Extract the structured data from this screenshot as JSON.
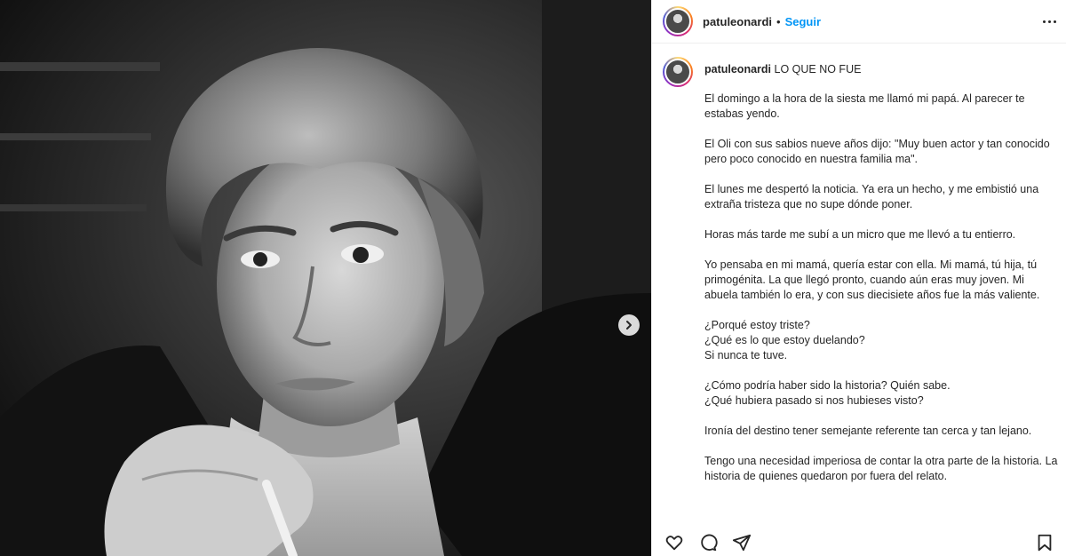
{
  "post": {
    "username": "patuleonardi",
    "separator": "•",
    "follow_label": "Seguir",
    "more_icon": "more-horizontal-icon"
  },
  "caption": {
    "username": "patuleonardi",
    "title": "LO QUE NO FUE",
    "paragraphs": [
      "El domingo a la hora de la siesta me llamó mi papá. Al parecer te estabas yendo.",
      "El Oli con sus sabios nueve años dijo: \"Muy buen actor y tan conocido pero poco conocido en nuestra familia ma\".",
      "El lunes me despertó la noticia. Ya era un hecho, y me embistió una extraña tristeza que no supe dónde poner.",
      "Horas más tarde me subí a un micro que me llevó a tu entierro.",
      "Yo pensaba en mi mamá, quería estar con ella. Mi mamá, tú hija, tú primogénita. La que llegó pronto, cuando aún eras muy joven. Mi abuela también lo era, y con sus diecisiete años fue la más valiente.",
      "¿Porqué estoy triste?\n¿Qué es lo que estoy duelando?\nSi nunca te tuve.",
      "¿Cómo podría haber sido la historia? Quién sabe.\n¿Qué hubiera pasado si nos hubieses visto?",
      "Ironía del destino tener semejante referente tan cerca y tan lejano.",
      "Tengo una necesidad imperiosa de contar la otra parte de la historia. La historia de quienes quedaron por fuera del relato."
    ]
  },
  "actions": {
    "like_icon": "heart-icon",
    "comment_icon": "comment-icon",
    "share_icon": "send-icon",
    "save_icon": "bookmark-icon"
  },
  "colors": {
    "link_blue": "#0095f6",
    "text": "#262626",
    "divider": "#efefef"
  }
}
